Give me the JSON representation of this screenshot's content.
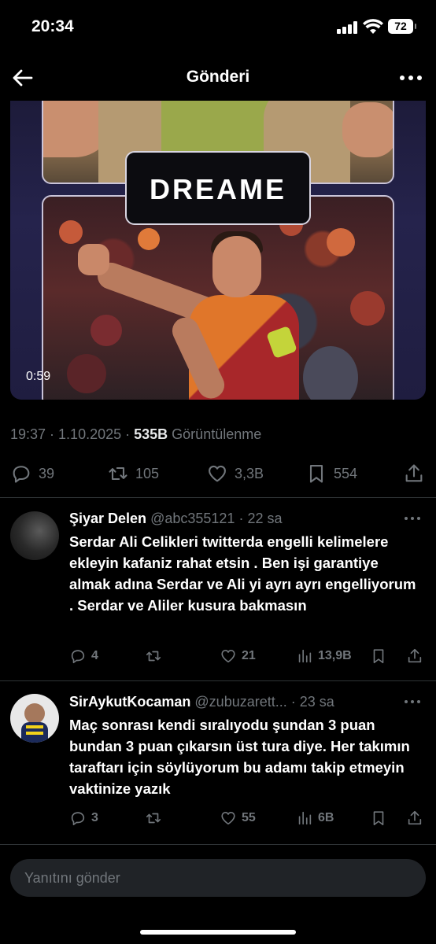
{
  "status_bar": {
    "time": "20:34",
    "battery": "72"
  },
  "header": {
    "title": "Gönderi",
    "back_icon": "arrow-left-icon",
    "more_icon": "more-horizontal-icon"
  },
  "media": {
    "brand": "DREAME",
    "duration": "0:59"
  },
  "post_meta": {
    "time": "19:37",
    "date": "1.10.2025",
    "views_count": "535B",
    "views_label": "Görüntülenme"
  },
  "post_actions": {
    "replies": "39",
    "reposts": "105",
    "likes": "3,3B",
    "bookmarks": "554"
  },
  "replies": [
    {
      "name": "Şiyar Delen",
      "handle": "@abc355121",
      "time": "22 sa",
      "text": "Serdar Ali Celikleri twitterda engelli kelimelere ekleyin kafaniz rahat etsin . Ben işi garantiye almak adına Serdar ve Ali yi ayrı ayrı engelliyorum . Serdar ve Aliler kusura bakmasın",
      "replies": "4",
      "reposts": "",
      "likes": "21",
      "views": "13,9B"
    },
    {
      "name": "SirAykutKocaman",
      "handle": "@zubuzarett...",
      "time": "23 sa",
      "text": "Maç sonrası kendi sıralıyodu şundan 3 puan bundan 3 puan çıkarsın üst tura diye. Her takımın taraftarı için söylüyorum bu adamı takip etmeyin vaktinize yazık",
      "replies": "3",
      "reposts": "",
      "likes": "55",
      "views": "6B"
    }
  ],
  "composer": {
    "placeholder": "Yanıtını gönder"
  },
  "colors": {
    "background": "#000000",
    "text": "#e7e9ea",
    "muted": "#71767b",
    "divider": "#2f3336"
  }
}
